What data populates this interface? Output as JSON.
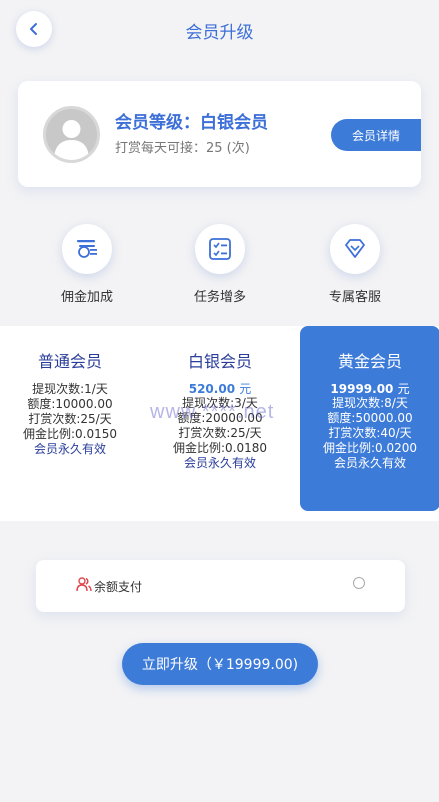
{
  "header": {
    "title": "会员升级"
  },
  "member": {
    "level_line": "会员等级：白银会员",
    "reward_line": "打赏每天可接：25 (次)",
    "detail_button": "会员详情"
  },
  "features": [
    {
      "label": "佣金加成",
      "icon": "coin-stack-icon"
    },
    {
      "label": "任务增多",
      "icon": "task-list-icon"
    },
    {
      "label": "专属客服",
      "icon": "diamond-icon"
    }
  ],
  "tiers": [
    {
      "name": "普通会员",
      "price": "",
      "price_unit": "",
      "lines": [
        "提现次数:1/天",
        "额度:10000.00",
        "打赏次数:25/天",
        "佣金比例:0.0150"
      ],
      "validity": "会员永久有效"
    },
    {
      "name": "白银会员",
      "price": "520.00",
      "price_unit": "元",
      "lines": [
        "提现次数:3/天",
        "额度:20000.00",
        "打赏次数:25/天",
        "佣金比例:0.0180"
      ],
      "validity": "会员永久有效"
    },
    {
      "name": "黄金会员",
      "price": "19999.00",
      "price_unit": "元",
      "lines": [
        "提现次数:8/天",
        "额度:50000.00",
        "打赏次数:40/天",
        "佣金比例:0.0200"
      ],
      "validity": "会员永久有效"
    }
  ],
  "watermark": "www.****.net",
  "payment": {
    "label": "余额支付"
  },
  "upgrade_button": "立即升级（￥19999.00)",
  "colors": {
    "accent": "#3d7bd9",
    "title_blue": "#3d6fd9",
    "tier_name": "#2a3d9a",
    "pay_icon": "#e0474c"
  }
}
